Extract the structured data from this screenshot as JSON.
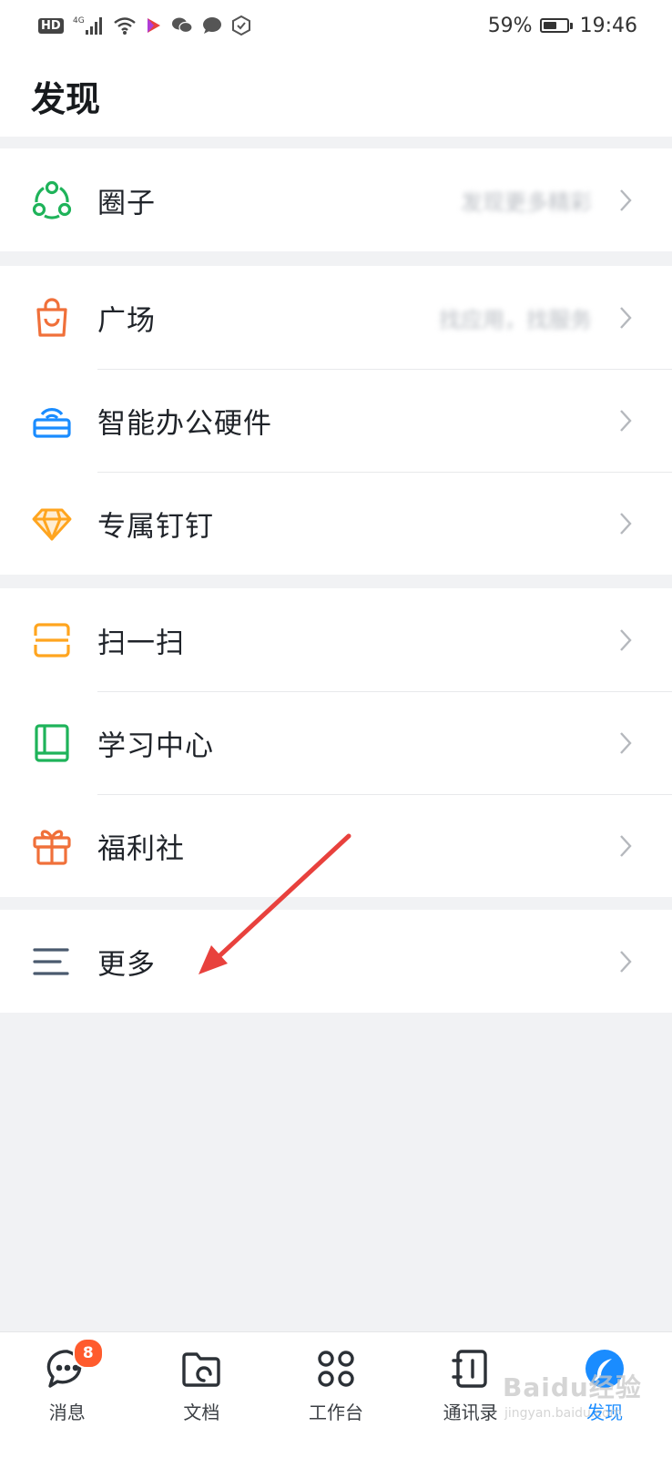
{
  "status_bar": {
    "network_badge": "HD",
    "network_type": "4G",
    "battery": "59%",
    "battery_level": 0.59,
    "time": "19:46"
  },
  "header": {
    "title": "发现"
  },
  "groups": [
    {
      "items": [
        {
          "label": "圈子",
          "sub": "发现更多精彩",
          "icon": "circle-network-icon",
          "color": "#1fb35a"
        }
      ]
    },
    {
      "items": [
        {
          "label": "广场",
          "sub": "找应用，找服务",
          "icon": "shopping-bag-icon",
          "color": "#f0703a"
        },
        {
          "label": "智能办公硬件",
          "sub": "",
          "icon": "router-icon",
          "color": "#1a8cff"
        },
        {
          "label": "专属钉钉",
          "sub": "",
          "icon": "diamond-icon",
          "color": "#ffa51f"
        }
      ]
    },
    {
      "items": [
        {
          "label": "扫一扫",
          "sub": "",
          "icon": "scan-icon",
          "color": "#ffa51f"
        },
        {
          "label": "学习中心",
          "sub": "",
          "icon": "book-icon",
          "color": "#1fb35a"
        },
        {
          "label": "福利社",
          "sub": "",
          "icon": "gift-icon",
          "color": "#f0703a"
        }
      ]
    },
    {
      "items": [
        {
          "label": "更多",
          "sub": "",
          "icon": "menu-lines-icon",
          "color": "#4a5a6e"
        }
      ]
    }
  ],
  "tabs": [
    {
      "label": "消息",
      "icon": "chat-icon",
      "badge": "8",
      "active": false
    },
    {
      "label": "文档",
      "icon": "folder-icon",
      "badge": "",
      "active": false
    },
    {
      "label": "工作台",
      "icon": "grid-icon",
      "badge": "",
      "active": false
    },
    {
      "label": "通讯录",
      "icon": "contacts-icon",
      "badge": "",
      "active": false
    },
    {
      "label": "发现",
      "icon": "discover-icon",
      "badge": "",
      "active": true
    }
  ],
  "watermark": {
    "text": "Baidu经验",
    "url_text": "jingyan.baidu.com"
  },
  "colors": {
    "accent": "#1a8cff",
    "badge": "#ff5b2d",
    "background": "#f1f2f4",
    "annotation_arrow": "#e8413d"
  }
}
